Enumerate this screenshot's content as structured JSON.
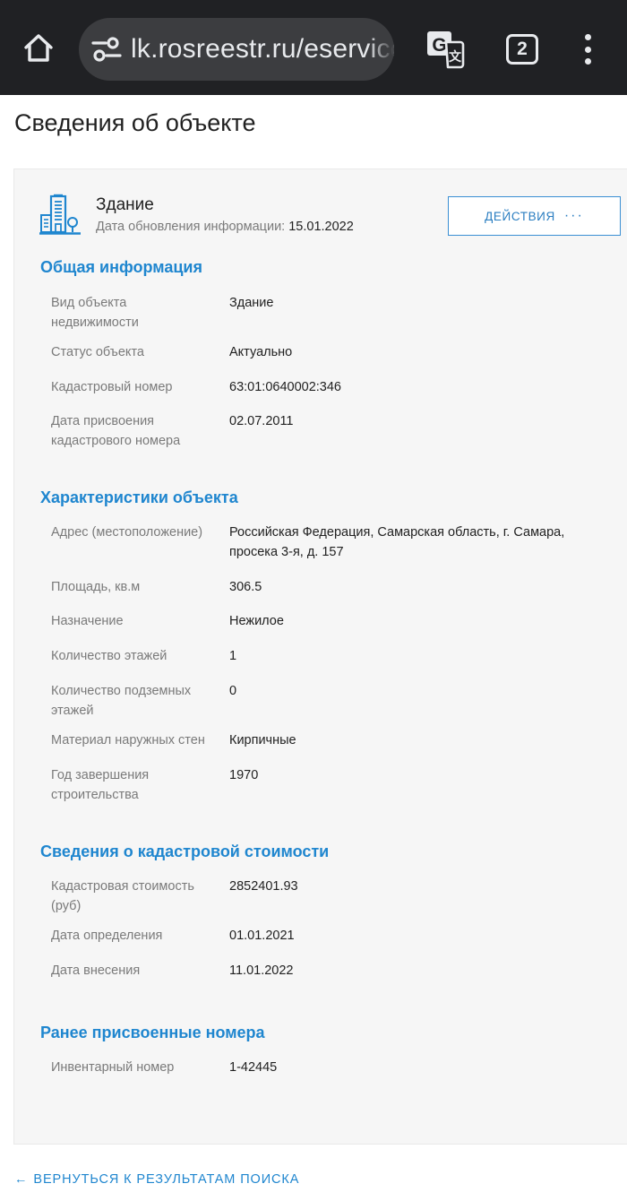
{
  "browser": {
    "url": "lk.rosreestr.ru/eservices/real-estate-objects-online",
    "tab_count": "2",
    "icons": {
      "home": "home-icon",
      "site_settings": "tune-icon",
      "translate": "google-translate-icon",
      "tabs": "tab-switcher-icon",
      "menu": "more-vert-icon"
    }
  },
  "page": {
    "title": "Сведения об объекте"
  },
  "object": {
    "icon": "building-icon",
    "type": "Здание",
    "update_label": "Дата обновления информации:",
    "update_date": "15.01.2022",
    "actions_label": "ДЕЙСТВИЯ",
    "actions_dots": "···"
  },
  "sections": {
    "general": {
      "title": "Общая информация",
      "rows": [
        {
          "label": "Вид объекта недвижимости",
          "value": "Здание"
        },
        {
          "label": "Статус объекта",
          "value": "Актуально"
        },
        {
          "label": "Кадастровый номер",
          "value": "63:01:0640002:346"
        },
        {
          "label": "Дата присвоения кадастрового номера",
          "value": "02.07.2011"
        }
      ]
    },
    "characteristics": {
      "title": "Характеристики объекта",
      "rows": [
        {
          "label": "Адрес (местоположение)",
          "value": "Российская Федерация, Самарская область, г. Самара, просека 3-я, д. 157"
        },
        {
          "label": "Площадь, кв.м",
          "value": "306.5"
        },
        {
          "label": "Назначение",
          "value": "Нежилое"
        },
        {
          "label": "Количество этажей",
          "value": "1"
        },
        {
          "label": "Количество подземных этажей",
          "value": "0"
        },
        {
          "label": "Материал наружных стен",
          "value": "Кирпичные"
        },
        {
          "label": "Год завершения строительства",
          "value": "1970"
        }
      ]
    },
    "cadastral_value": {
      "title": "Сведения о кадастровой стоимости",
      "rows": [
        {
          "label": "Кадастровая стоимость (руб)",
          "value": "2852401.93"
        },
        {
          "label": "Дата определения",
          "value": "01.01.2021"
        },
        {
          "label": "Дата внесения",
          "value": "11.01.2022"
        }
      ]
    },
    "previous_numbers": {
      "title": "Ранее присвоенные номера",
      "rows": [
        {
          "label": "Инвентарный номер",
          "value": "1-42445"
        }
      ]
    }
  },
  "footer": {
    "back_arrow": "←",
    "back_label": "ВЕРНУТЬСЯ К РЕЗУЛЬТАТАМ ПОИСКА"
  },
  "colors": {
    "accent": "#1f86cf",
    "toolbar": "#202124",
    "card_bg": "#f6f6f6",
    "label_gray": "#7a7a7a"
  }
}
